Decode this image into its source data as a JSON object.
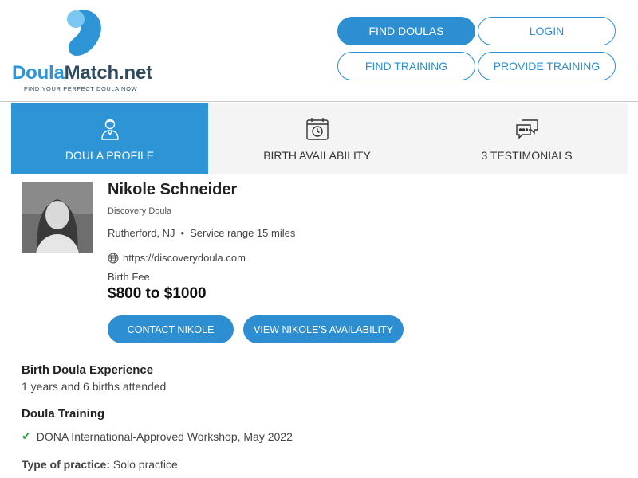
{
  "brand": {
    "name_part1": "Doula",
    "name_part2": "Match.net",
    "tagline": "FIND YOUR PERFECT DOULA NOW"
  },
  "nav": {
    "find_doulas": "FIND DOULAS",
    "login": "LOGIN",
    "find_training": "FIND TRAINING",
    "provide_training": "PROVIDE TRAINING"
  },
  "tabs": [
    {
      "label": "DOULA PROFILE",
      "icon": "person-icon",
      "active": true
    },
    {
      "label": "BIRTH AVAILABILITY",
      "icon": "calendar-clock-icon",
      "active": false
    },
    {
      "label": "3 TESTIMONIALS",
      "icon": "chat-bubbles-icon",
      "active": false
    }
  ],
  "profile": {
    "name": "Nikole Schneider",
    "business": "Discovery Doula",
    "location": "Rutherford, NJ",
    "separator": "•",
    "service_range": "Service range 15 miles",
    "website": "https://discoverydoula.com",
    "fee_label": "Birth Fee",
    "fee": "$800 to $1000",
    "contact_button": "CONTACT NIKOLE",
    "availability_button": "VIEW NIKOLE'S AVAILABILITY"
  },
  "experience": {
    "title": "Birth Doula Experience",
    "text": "1 years and 6 births attended"
  },
  "training": {
    "title": "Doula Training",
    "items": [
      "DONA International-Approved Workshop, May 2022"
    ]
  },
  "practice": {
    "label": "Type of practice:",
    "value": "Solo practice"
  },
  "colors": {
    "accent": "#2d8fd2",
    "tab_active": "#2d95d6",
    "check": "#2aa24a"
  }
}
